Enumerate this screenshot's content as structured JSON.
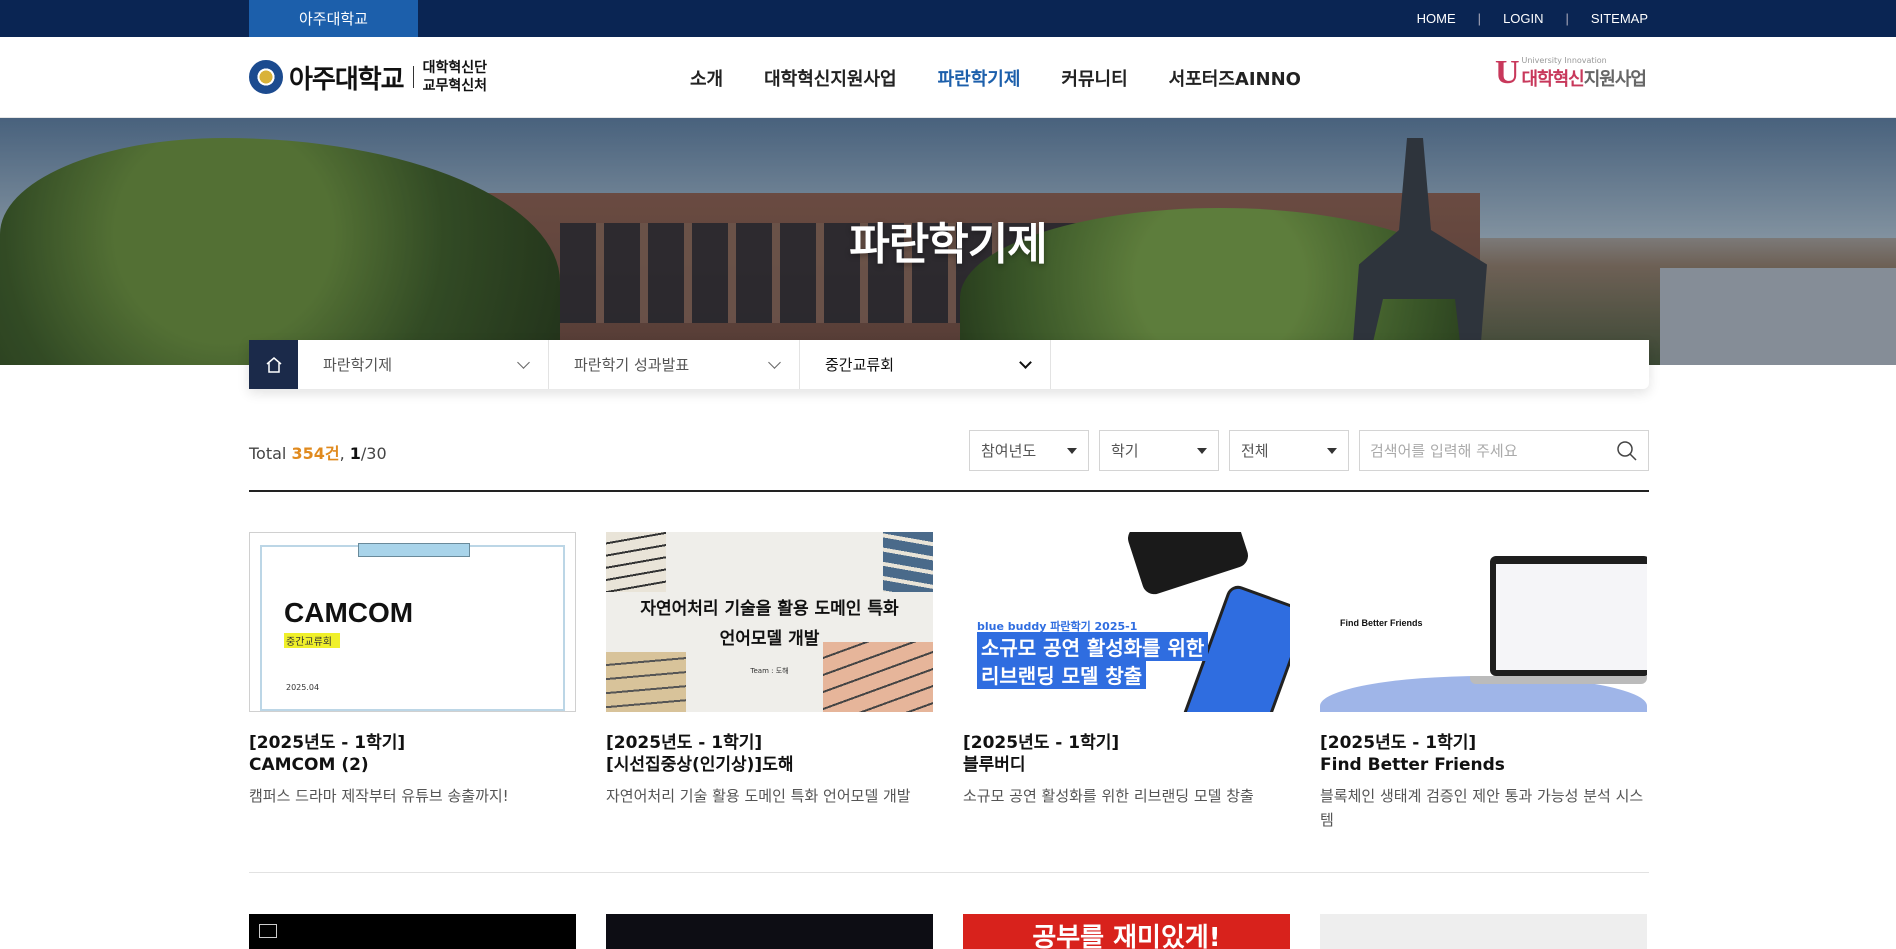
{
  "topbar": {
    "university_tab": "아주대학교",
    "util_links": [
      "HOME",
      "LOGIN",
      "SITEMAP"
    ]
  },
  "header": {
    "logo_name": "아주대학교",
    "logo_sub_1": "대학혁신단",
    "logo_sub_2": "교무혁신처",
    "nav": [
      "소개",
      "대학혁신지원사업",
      "파란학기제",
      "커뮤니티",
      "서포터즈AINNO"
    ],
    "active_nav": "파란학기제",
    "partner_small": "University Innovation",
    "partner_red": "대학혁신",
    "partner_gray": "지원사업"
  },
  "hero": {
    "title": "파란학기제"
  },
  "location": {
    "level1": "파란학기제",
    "level2": "파란학기 성과발표",
    "level3": "중간교류회"
  },
  "list": {
    "total_label": "Total ",
    "total_count": "354건",
    "page_current": "1",
    "page_total": "/30",
    "filters": [
      "참여년도",
      "학기",
      "전체"
    ],
    "search_placeholder": "검색어를 입력해 주세요"
  },
  "cards": [
    {
      "category": "[2025년도 - 1학기]",
      "title": "CAMCOM (2)",
      "desc": "캠퍼스 드라마 제작부터 유튜브 송출까지!",
      "thumb": {
        "big": "CAMCOM",
        "tag": "중간교류회",
        "date": "2025.04"
      }
    },
    {
      "category": "[2025년도 - 1학기]",
      "title": "[시선집중상(인기상)]도해",
      "desc": "자연어처리 기술 활용 도메인 특화 언어모델 개발",
      "thumb": {
        "line1": "자연어처리 기술을 활용 도메인 특화",
        "line2": "언어모델 개발",
        "team": "Team : 도해"
      }
    },
    {
      "category": "[2025년도 - 1학기]",
      "title": "블루버디",
      "desc": "소규모 공연 활성화를 위한 리브랜딩 모델 창출",
      "thumb": {
        "brand": "blue buddy  파란학기 2025-1",
        "line1": "소규모 공연 활성화를 위한",
        "line2": "리브랜딩 모델 창출"
      }
    },
    {
      "category": "[2025년도 - 1학기]",
      "title": "Find Better Friends",
      "desc": "블록체인 생태계 검증인 제안 통과 가능성 분석 시스템",
      "thumb": {
        "heading": "Find Better Friends"
      }
    }
  ],
  "row2": {
    "peek3": "공부를 재미있게!"
  }
}
